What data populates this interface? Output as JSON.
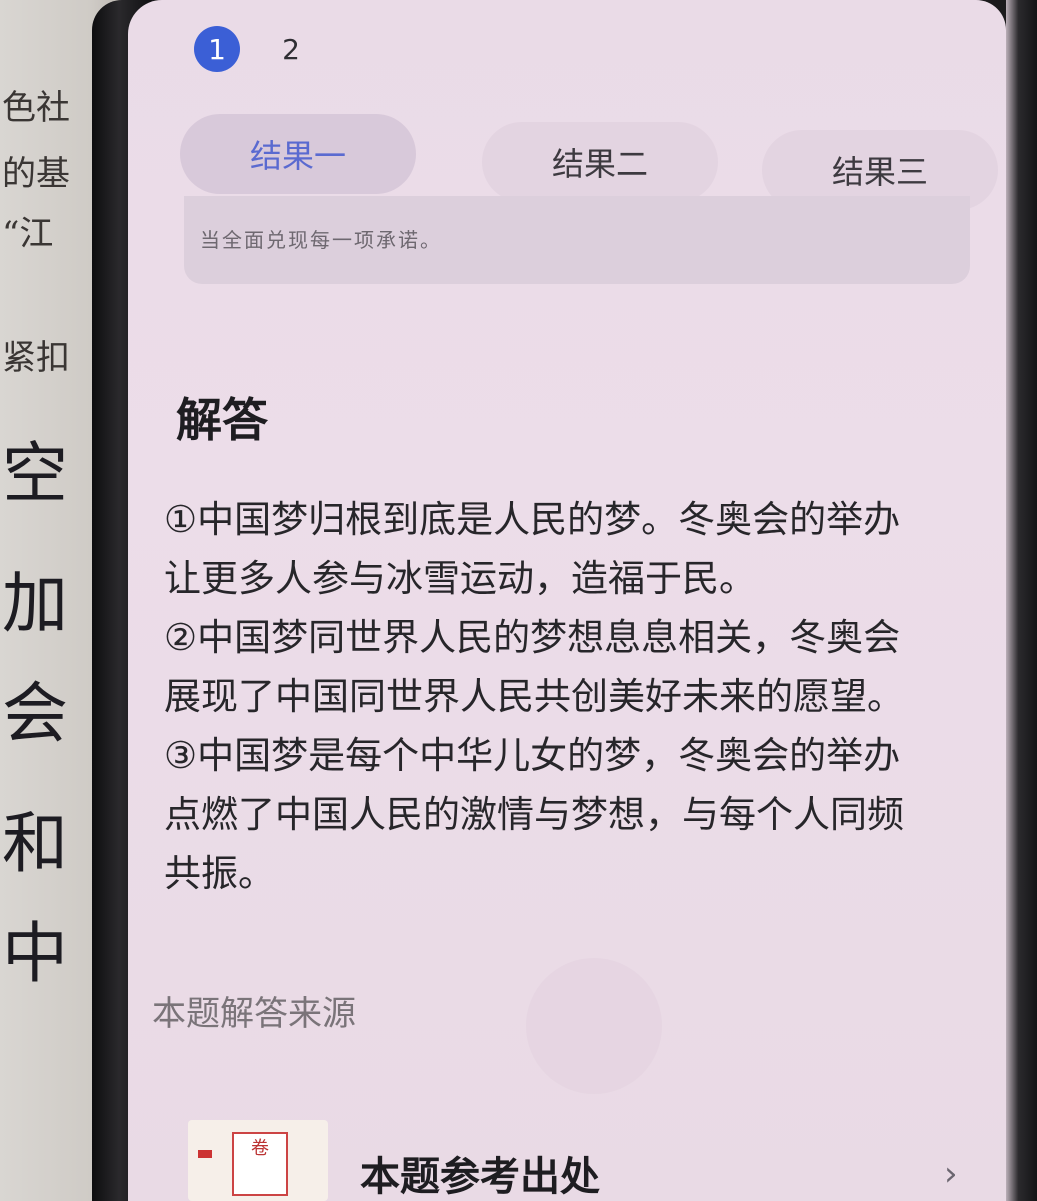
{
  "pager": {
    "pages": [
      "1",
      "2"
    ],
    "active": "1"
  },
  "tabs": [
    "结果一",
    "结果二",
    "结果三"
  ],
  "previous_card": {
    "visible_text": "当全面兑现每一项承诺。"
  },
  "answer": {
    "heading": "解答",
    "lines": [
      "①中国梦归根到底是人民的梦。冬奥会的举办",
      "让更多人参与冰雪运动，造福于民。",
      "②中国梦同世界人民的梦想息息相关，冬奥会",
      "展现了中国同世界人民共创美好未来的愿望。",
      "③中国梦是每个中华儿女的梦，冬奥会的举办",
      "点燃了中国人民的激情与梦想，与每个人同频",
      "共振。"
    ]
  },
  "source": {
    "label": "本题解答来源",
    "ref_title": "本题参考出处",
    "book_text": "卷"
  },
  "paper_background": {
    "lines": [
      "色社",
      "的基",
      "“江",
      "紧扣"
    ],
    "handwriting": [
      "空",
      "加",
      "会",
      "和",
      "中"
    ]
  },
  "colors": {
    "accent": "#3b5fd6",
    "tab_active_text": "#5a6ad0"
  },
  "icons": {
    "chevron": "chevron-right-icon"
  }
}
